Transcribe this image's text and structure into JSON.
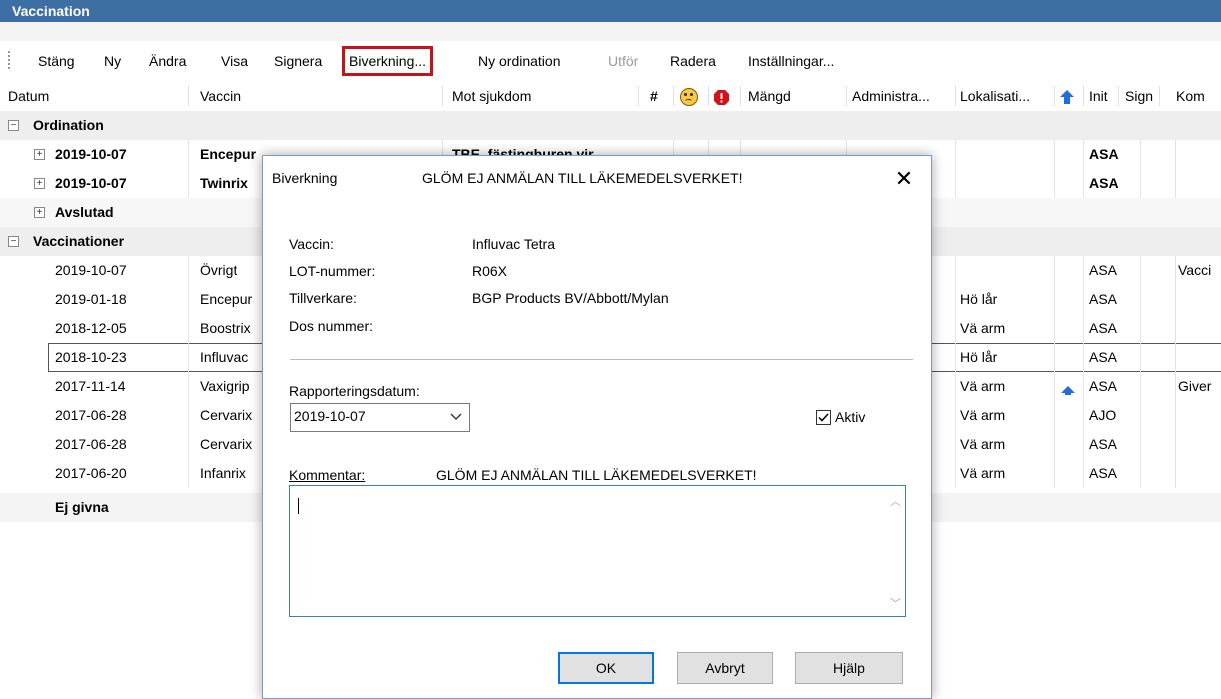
{
  "window": {
    "title": "Vaccination"
  },
  "toolbar": {
    "items": [
      {
        "label": "Stäng"
      },
      {
        "label": "Ny"
      },
      {
        "label": "Ändra"
      },
      {
        "label": "Visa"
      },
      {
        "label": "Signera"
      },
      {
        "label": "Biverkning..."
      },
      {
        "label": "Ny ordination"
      },
      {
        "label": "Utför"
      },
      {
        "label": "Radera"
      },
      {
        "label": "Inställningar..."
      }
    ]
  },
  "columns": {
    "datum": "Datum",
    "vaccin": "Vaccin",
    "mot_sjukdom": "Mot sjukdom",
    "hash": "#",
    "mangd": "Mängd",
    "administra": "Administra...",
    "lokalisati": "Lokalisati...",
    "init": "Init",
    "sign": "Sign",
    "kom": "Kom"
  },
  "groups": {
    "ordination": "Ordination",
    "avslutad": "Avslutad",
    "vaccinationer": "Vaccinationer",
    "ej_givna": "Ej givna"
  },
  "ordination_rows": [
    {
      "datum": "2019-10-07",
      "vaccin": "Encepur",
      "mot": "TBE, fästingburen vir...",
      "init": "ASA"
    },
    {
      "datum": "2019-10-07",
      "vaccin": "Twinrix",
      "mot": "",
      "init": "ASA"
    }
  ],
  "vaccination_rows": [
    {
      "datum": "2019-10-07",
      "vaccin": "Övrigt",
      "lokal": "",
      "init": "ASA",
      "kom": "Vacci"
    },
    {
      "datum": "2019-01-18",
      "vaccin": "Encepur",
      "lokal": "Hö lår",
      "init": "ASA",
      "kom": ""
    },
    {
      "datum": "2018-12-05",
      "vaccin": "Boostrix",
      "lokal": "Vä arm",
      "init": "ASA",
      "kom": ""
    },
    {
      "datum": "2018-10-23",
      "vaccin": "Influvac",
      "lokal": "Hö lår",
      "init": "ASA",
      "kom": ""
    },
    {
      "datum": "2017-11-14",
      "vaccin": "Vaxigrip",
      "lokal": "Vä arm",
      "init": "ASA",
      "kom": "Giver"
    },
    {
      "datum": "2017-06-28",
      "vaccin": "Cervarix",
      "lokal": "Vä arm",
      "init": "AJO",
      "kom": ""
    },
    {
      "datum": "2017-06-28",
      "vaccin": "Cervarix",
      "lokal": "Vä arm",
      "init": "ASA",
      "kom": ""
    },
    {
      "datum": "2017-06-20",
      "vaccin": "Infanrix",
      "lokal": "Vä arm",
      "init": "ASA",
      "kom": ""
    }
  ],
  "dialog": {
    "title": "Biverkning",
    "title_warning": "GLÖM EJ ANMÄLAN TILL LÄKEMEDELSVERKET!",
    "fields": {
      "vaccin_label": "Vaccin:",
      "vaccin_value": "Influvac Tetra",
      "lot_label": "LOT-nummer:",
      "lot_value": "R06X",
      "tillverkare_label": "Tillverkare:",
      "tillverkare_value": "BGP Products BV/Abbott/Mylan",
      "dos_label": "Dos nummer:",
      "dos_value": ""
    },
    "rapport_label": "Rapporteringsdatum:",
    "rapport_value": "2019-10-07",
    "aktiv_label": "Aktiv",
    "aktiv_checked": true,
    "kommentar_label": "Kommentar:",
    "kommentar_warning": "GLÖM EJ ANMÄLAN TILL LÄKEMEDELSVERKET!",
    "kommentar_value": "",
    "buttons": {
      "ok": "OK",
      "cancel": "Avbryt",
      "help": "Hjälp"
    }
  },
  "icons": {
    "sad_face": "sad-face-icon",
    "alert": "alert-icon",
    "up_arrow": "up-arrow-icon",
    "close": "close-icon",
    "chevron": "chevron-down-icon"
  },
  "colors": {
    "titlebar": "#3d6fa5",
    "highlight_border": "#c0161b",
    "group_bg": "#eeeeee",
    "up_arrow": "#1e6fd9",
    "alert": "#d0121b"
  }
}
